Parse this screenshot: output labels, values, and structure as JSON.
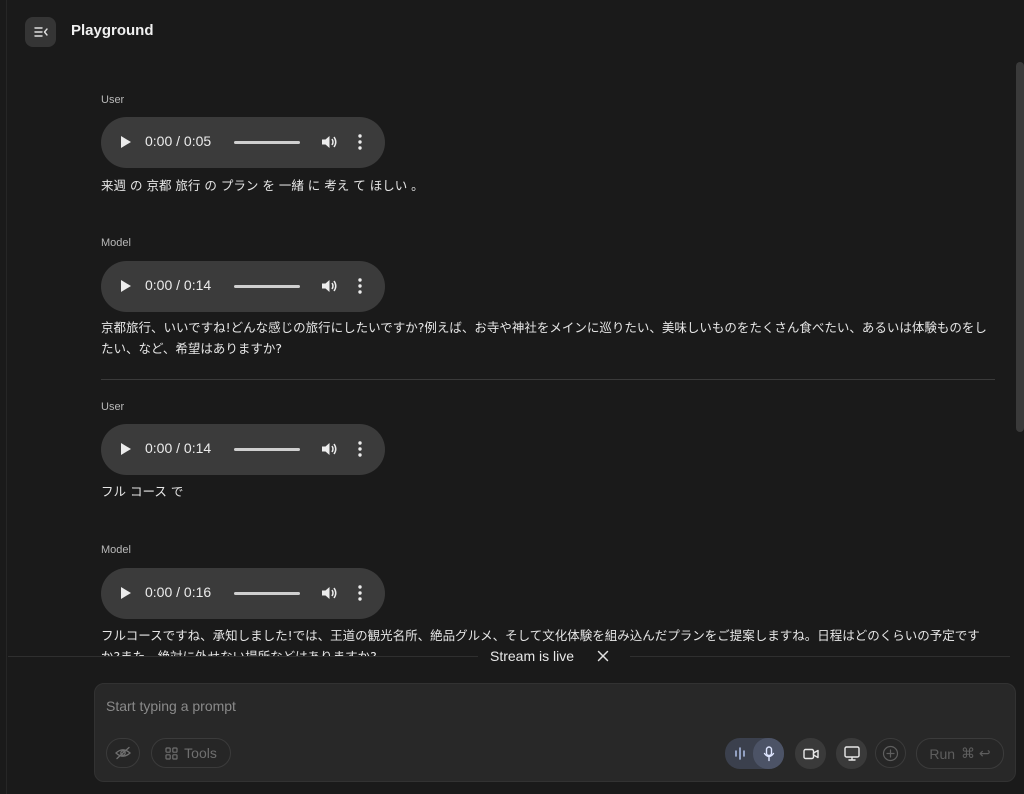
{
  "header": {
    "title": "Playground"
  },
  "messages": [
    {
      "role": "User",
      "audio_time": "0:00 / 0:05",
      "text": "来週 の 京都 旅行 の プラン を 一緒 に 考え て ほしい 。"
    },
    {
      "role": "Model",
      "audio_time": "0:00 / 0:14",
      "text": "京都旅行、いいですね!どんな感じの旅行にしたいですか?例えば、お寺や神社をメインに巡りたい、美味しいものをたくさん食べたい、あるいは体験ものをしたい、など、希望はありますか?"
    },
    {
      "role": "User",
      "audio_time": "0:00 / 0:14",
      "text": "フル コース で"
    },
    {
      "role": "Model",
      "audio_time": "0:00 / 0:16",
      "text": "フルコースですね、承知しました!では、王道の観光名所、絶品グルメ、そして文化体験を組み込んだプランをご提案しますね。日程はどのくらいの予定ですか?また、絶対に外せない場所などはありますか?"
    }
  ],
  "stream": {
    "status": "Stream is live"
  },
  "prompt": {
    "placeholder": "Start typing a prompt",
    "tools_label": "Tools",
    "run_label": "Run",
    "run_shortcut": "⌘ ↩"
  },
  "colors": {
    "background": "#1a1a1a",
    "surface": "#282828",
    "player": "#3b3b3b",
    "mic_accent": "#4c5366"
  }
}
